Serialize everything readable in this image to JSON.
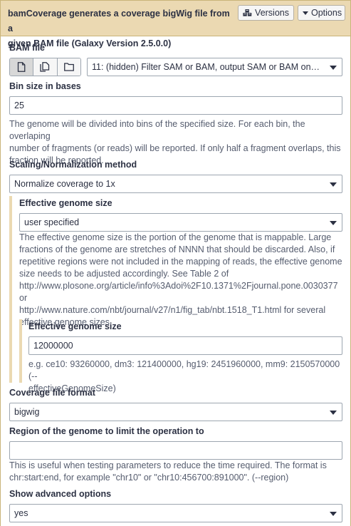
{
  "header": {
    "title_line1": "bamCoverage generates a coverage bigWig file from a",
    "title_line2": "given BAM file (Galaxy Version 2.5.0.0)",
    "versions_label": "Versions",
    "options_label": "Options",
    "versions_icon": "cubes-icon",
    "options_icon": "caret-down-icon"
  },
  "bam_file": {
    "label": "BAM file",
    "mode_buttons": [
      {
        "icon": "file-icon",
        "active": true
      },
      {
        "icon": "files-icon",
        "active": false
      },
      {
        "icon": "folder-icon",
        "active": false
      }
    ],
    "selected": "11: (hidden) Filter SAM or BAM, output SAM or BAM on d..."
  },
  "bin_size": {
    "label": "Bin size in bases",
    "value": "25",
    "help_lines": [
      "The genome will be divided into bins of the specified size. For each bin, the overlaping",
      "number of fragments (or reads) will be reported. If only half a fragment overlaps, this",
      "fraction will be reported."
    ]
  },
  "scaling": {
    "label": "Scaling/Normalization method",
    "selected": "Normalize coverage to 1x"
  },
  "effective_genome": {
    "label": "Effective genome size",
    "selected": "user specified",
    "help_lines": [
      "The effective genome size is the portion of the genome that is mappable. Large",
      "fractions of the genome are stretches of NNNN that should be discarded. Also, if",
      "repetitive regions were not included in the mapping of reads, the effective genome",
      "size needs to be adjusted accordingly. See Table 2 of",
      "http://www.plosone.org/article/info%3Adoi%2F10.1371%2Fjournal.pone.0030377 or",
      "http://www.nature.com/nbt/journal/v27/n1/fig_tab/nbt.1518_T1.html for several",
      "effective genome sizes."
    ],
    "nested": {
      "label": "Effective genome size",
      "value": "12000000",
      "help_lines": [
        "e.g. ce10: 93260000, dm3: 121400000, hg19: 2451960000, mm9: 2150570000 (--",
        "effectiveGenomeSize)"
      ]
    }
  },
  "coverage_format": {
    "label": "Coverage file format",
    "selected": "bigwig"
  },
  "region": {
    "label": "Region of the genome to limit the operation to",
    "value": "",
    "help_lines": [
      "This is useful when testing parameters to reduce the time required. The format is",
      "chr:start:end, for example \"chr10\" or \"chr10:456700:891000\". (--region)"
    ]
  },
  "advanced": {
    "label": "Show advanced options",
    "selected": "yes"
  },
  "colors": {
    "header_bg": "#ebd9b2",
    "border": "#c9b47a",
    "text": "#2c3143",
    "help_text": "#555c6e"
  }
}
